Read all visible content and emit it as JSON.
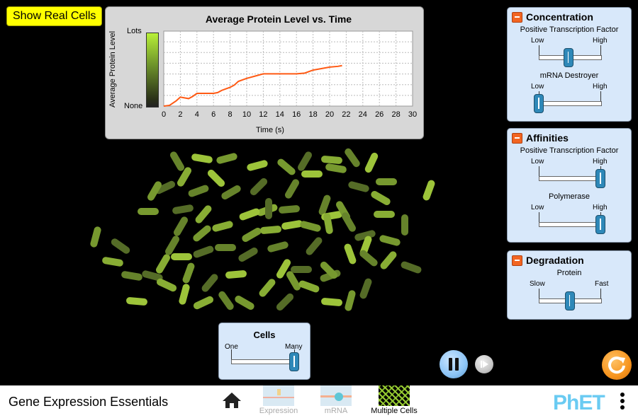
{
  "app": {
    "title": "Gene Expression Essentials"
  },
  "show_real_cells_button": "Show Real Cells",
  "chart_data": {
    "type": "line",
    "title": "Average Protein Level vs. Time",
    "xlabel": "Time (s)",
    "ylabel": "Average Protein Level",
    "xlim": [
      0,
      30
    ],
    "x_ticks": [
      "0",
      "2",
      "4",
      "6",
      "8",
      "10",
      "12",
      "14",
      "16",
      "18",
      "20",
      "22",
      "24",
      "26",
      "28",
      "30"
    ],
    "ylim": [
      0,
      1
    ],
    "y_tick_labels": {
      "top": "Lots",
      "bottom": "None"
    },
    "grid": true,
    "series": [
      {
        "name": "Average Protein Level",
        "color": "#ff5a14",
        "x": [
          0,
          0.7,
          1.5,
          2,
          2.5,
          3,
          3.5,
          4,
          5,
          6,
          6.5,
          7,
          7.5,
          8,
          8.5,
          9,
          10,
          11,
          12,
          13,
          14,
          15,
          16,
          17,
          18,
          19,
          20,
          21,
          21.5
        ],
        "y": [
          0,
          0.01,
          0.07,
          0.12,
          0.11,
          0.1,
          0.13,
          0.17,
          0.17,
          0.17,
          0.18,
          0.21,
          0.23,
          0.25,
          0.28,
          0.33,
          0.37,
          0.4,
          0.43,
          0.43,
          0.43,
          0.43,
          0.43,
          0.44,
          0.48,
          0.5,
          0.52,
          0.53,
          0.54
        ]
      }
    ]
  },
  "panels": {
    "concentration": {
      "title": "Concentration",
      "sliders": [
        {
          "label": "Positive Transcription Factor",
          "min_label": "Low",
          "max_label": "High",
          "value": 0.48
        },
        {
          "label": "mRNA Destroyer",
          "min_label": "Low",
          "max_label": "High",
          "value": 0.0
        }
      ]
    },
    "affinities": {
      "title": "Affinities",
      "sliders": [
        {
          "label": "Positive Transcription Factor",
          "min_label": "Low",
          "max_label": "High",
          "value": 1.0
        },
        {
          "label": "Polymerase",
          "min_label": "Low",
          "max_label": "High",
          "value": 1.0
        }
      ]
    },
    "degradation": {
      "title": "Degradation",
      "sliders": [
        {
          "label": "Protein",
          "min_label": "Slow",
          "max_label": "Fast",
          "value": 0.5
        }
      ]
    },
    "cells": {
      "title": "Cells",
      "min_label": "One",
      "max_label": "Many",
      "value": 1.0
    }
  },
  "cell_colors": [
    "#9dc43a",
    "#88ad34",
    "#77992f",
    "#66832b",
    "#556c27"
  ],
  "playback": {
    "state": "playing"
  },
  "nav": {
    "screens": [
      {
        "label": "Expression",
        "selected": false
      },
      {
        "label": "mRNA",
        "selected": false
      },
      {
        "label": "Multiple Cells",
        "selected": true
      }
    ],
    "logo": "PhET"
  }
}
